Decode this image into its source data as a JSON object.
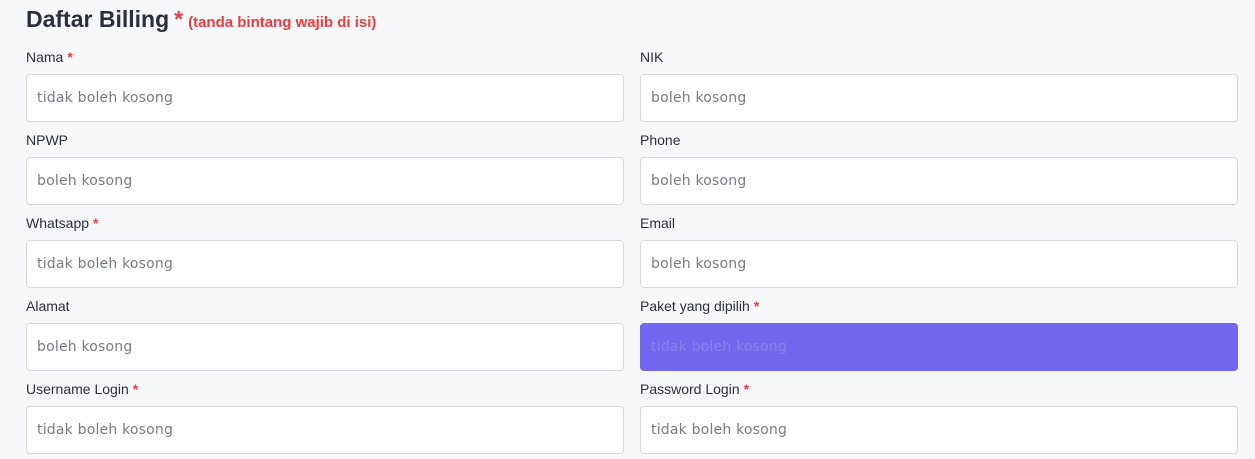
{
  "header": {
    "title": "Daftar Billing",
    "star": "*",
    "note": "(tanda bintang wajib di isi)"
  },
  "required_marker": "*",
  "colors": {
    "required": "#e53e3e",
    "active_field": "#7367f0"
  },
  "fields": {
    "nama": {
      "label": "Nama",
      "required": true,
      "placeholder": "tidak boleh kosong",
      "value": ""
    },
    "nik": {
      "label": "NIK",
      "required": false,
      "placeholder": "boleh kosong",
      "value": ""
    },
    "npwp": {
      "label": "NPWP",
      "required": false,
      "placeholder": "boleh kosong",
      "value": ""
    },
    "phone": {
      "label": "Phone",
      "required": false,
      "placeholder": "boleh kosong",
      "value": ""
    },
    "whatsapp": {
      "label": "Whatsapp",
      "required": true,
      "placeholder": "tidak boleh kosong",
      "value": ""
    },
    "email": {
      "label": "Email",
      "required": false,
      "placeholder": "boleh kosong",
      "value": ""
    },
    "alamat": {
      "label": "Alamat",
      "required": false,
      "placeholder": "boleh kosong",
      "value": ""
    },
    "paket": {
      "label": "Paket yang dipilih",
      "required": true,
      "placeholder": "tidak boleh kosong",
      "value": ""
    },
    "username": {
      "label": "Username Login",
      "required": true,
      "placeholder": "tidak boleh kosong",
      "value": ""
    },
    "password": {
      "label": "Password Login",
      "required": true,
      "placeholder": "tidak boleh kosong",
      "value": ""
    }
  }
}
